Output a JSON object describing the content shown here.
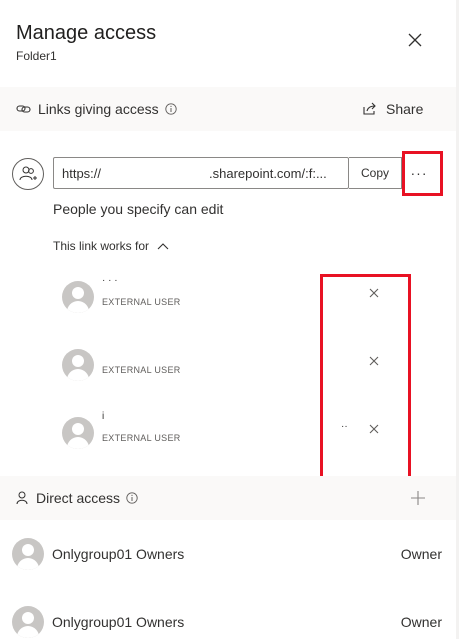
{
  "header": {
    "title": "Manage access",
    "subtitle": "Folder1"
  },
  "links_section": {
    "label": "Links giving access",
    "share_label": "Share",
    "url_prefix": "https://",
    "url_domain": ".sharepoint.com/:f:...",
    "copy_label": "Copy",
    "more_label": "···",
    "description": "People you specify can edit",
    "works_for_label": "This link works for",
    "users": [
      {
        "name": "·  ·  ·",
        "type": "EXTERNAL USER"
      },
      {
        "name": "",
        "type": "EXTERNAL USER"
      },
      {
        "name": "i",
        "type": "EXTERNAL USER"
      }
    ],
    "stray_mark": "··"
  },
  "direct_section": {
    "label": "Direct access",
    "members": [
      {
        "name": "Onlygroup01 Owners",
        "role": "Owner"
      },
      {
        "name": "Onlygroup01 Owners",
        "role": "Owner"
      }
    ]
  },
  "colors": {
    "highlight": "#e81123",
    "band": "#faf9f8",
    "avatar": "#c8c6c4"
  }
}
